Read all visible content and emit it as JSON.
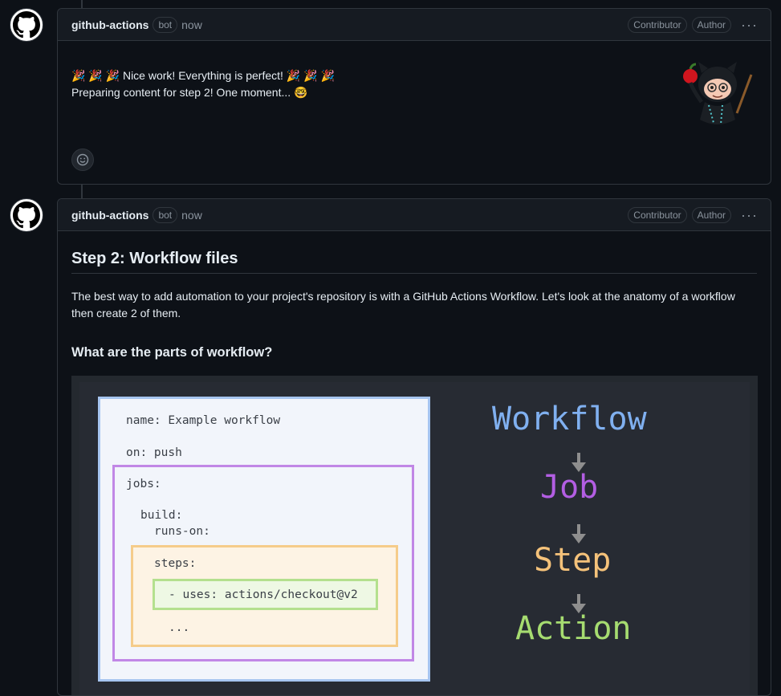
{
  "comments": [
    {
      "author": "github-actions",
      "badge": "bot",
      "time": "now",
      "labels": [
        "Contributor",
        "Author"
      ],
      "lines": [
        "🎉 🎉 🎉  Nice work! Everything is perfect! 🎉 🎉 🎉",
        "Preparing content for step 2! One moment... 🤓"
      ],
      "reaction_icon": "smiley-icon"
    },
    {
      "author": "github-actions",
      "badge": "bot",
      "time": "now",
      "labels": [
        "Contributor",
        "Author"
      ],
      "heading": "Step 2: Workflow files",
      "paragraph": "The best way to add automation to your project's repository is with a GitHub Actions Workflow. Let's look at the anatomy of a workflow then create 2 of them.",
      "subheading": "What are the parts of workflow?",
      "diagram": {
        "code": {
          "name_line": "name: Example workflow",
          "on_line": "on: push",
          "jobs_line": "jobs:",
          "build_line": "build:",
          "runs_on_line": "runs-on:",
          "steps_line": "steps:",
          "uses_line": "- uses: actions/checkout@v2",
          "ellipsis": "..."
        },
        "hierarchy": [
          "Workflow",
          "Job",
          "Step",
          "Action"
        ],
        "colors": {
          "workflow": "#80b0f0",
          "job": "#b35ee3",
          "step": "#f5c27a",
          "action": "#a6dc70"
        }
      }
    }
  ]
}
